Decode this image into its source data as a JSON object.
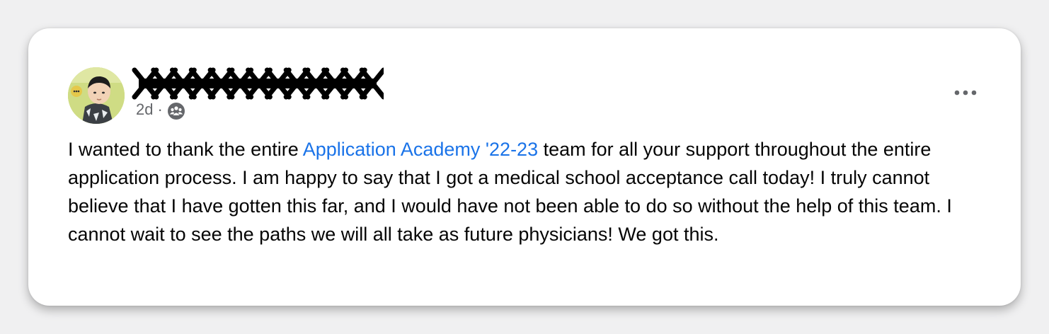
{
  "post": {
    "author_name": "XXXXXXXXXXXXX",
    "timestamp": "2d",
    "separator": "·",
    "audience_icon": "group-audience-icon",
    "more_options_icon": "more-horizontal-icon",
    "text_before_link": "I wanted to thank the entire ",
    "link_text": "Application Academy '22-23",
    "text_after_link": " team for all your support throughout the entire application process. I am happy to say that I got a medical school acceptance call today! I truly cannot believe that I have gotten this far, and I would have not been able to do so without the help of this team. I cannot wait to see the paths we will all take as future physicians! We got this."
  },
  "colors": {
    "link": "#1a73e8",
    "meta_text": "#65676b",
    "body_text": "#050505",
    "background": "#f0f0f1",
    "card": "#ffffff"
  }
}
